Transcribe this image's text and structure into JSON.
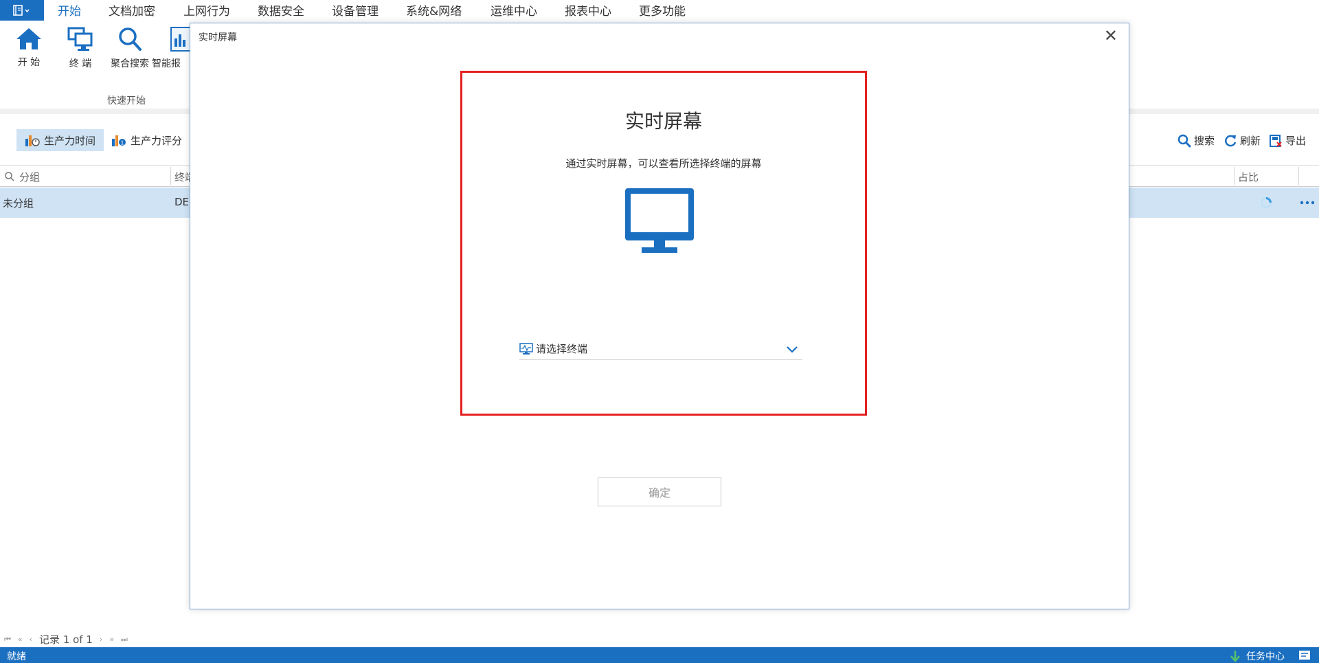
{
  "menu": {
    "tabs": [
      "开始",
      "文档加密",
      "上网行为",
      "数据安全",
      "设备管理",
      "系统&网络",
      "运维中心",
      "报表中心",
      "更多功能"
    ]
  },
  "ribbon": {
    "buttons": [
      "开 始",
      "终 端",
      "聚合搜索",
      "智能报"
    ],
    "group_label": "快速开始"
  },
  "toolbar": {
    "tabs": [
      "生产力时间",
      "生产力评分"
    ],
    "search": "搜索",
    "refresh": "刷新",
    "export": "导出"
  },
  "grid": {
    "headers": {
      "group": "分组",
      "terminal": "终端",
      "ratio": "占比"
    },
    "rows": [
      {
        "group": "未分组",
        "terminal": "DES"
      }
    ]
  },
  "pager": {
    "text": "记录 1 of 1"
  },
  "status": {
    "left": "就绪",
    "task_center": "任务中心"
  },
  "dialog": {
    "title": "实时屏幕",
    "heading": "实时屏幕",
    "description": "通过实时屏幕，可以查看所选择终端的屏幕",
    "select_placeholder": "请选择终端",
    "confirm": "确定"
  },
  "colors": {
    "accent": "#1b6fc1",
    "highlight_border": "#e52020",
    "row_selected": "#cfe3f5"
  }
}
